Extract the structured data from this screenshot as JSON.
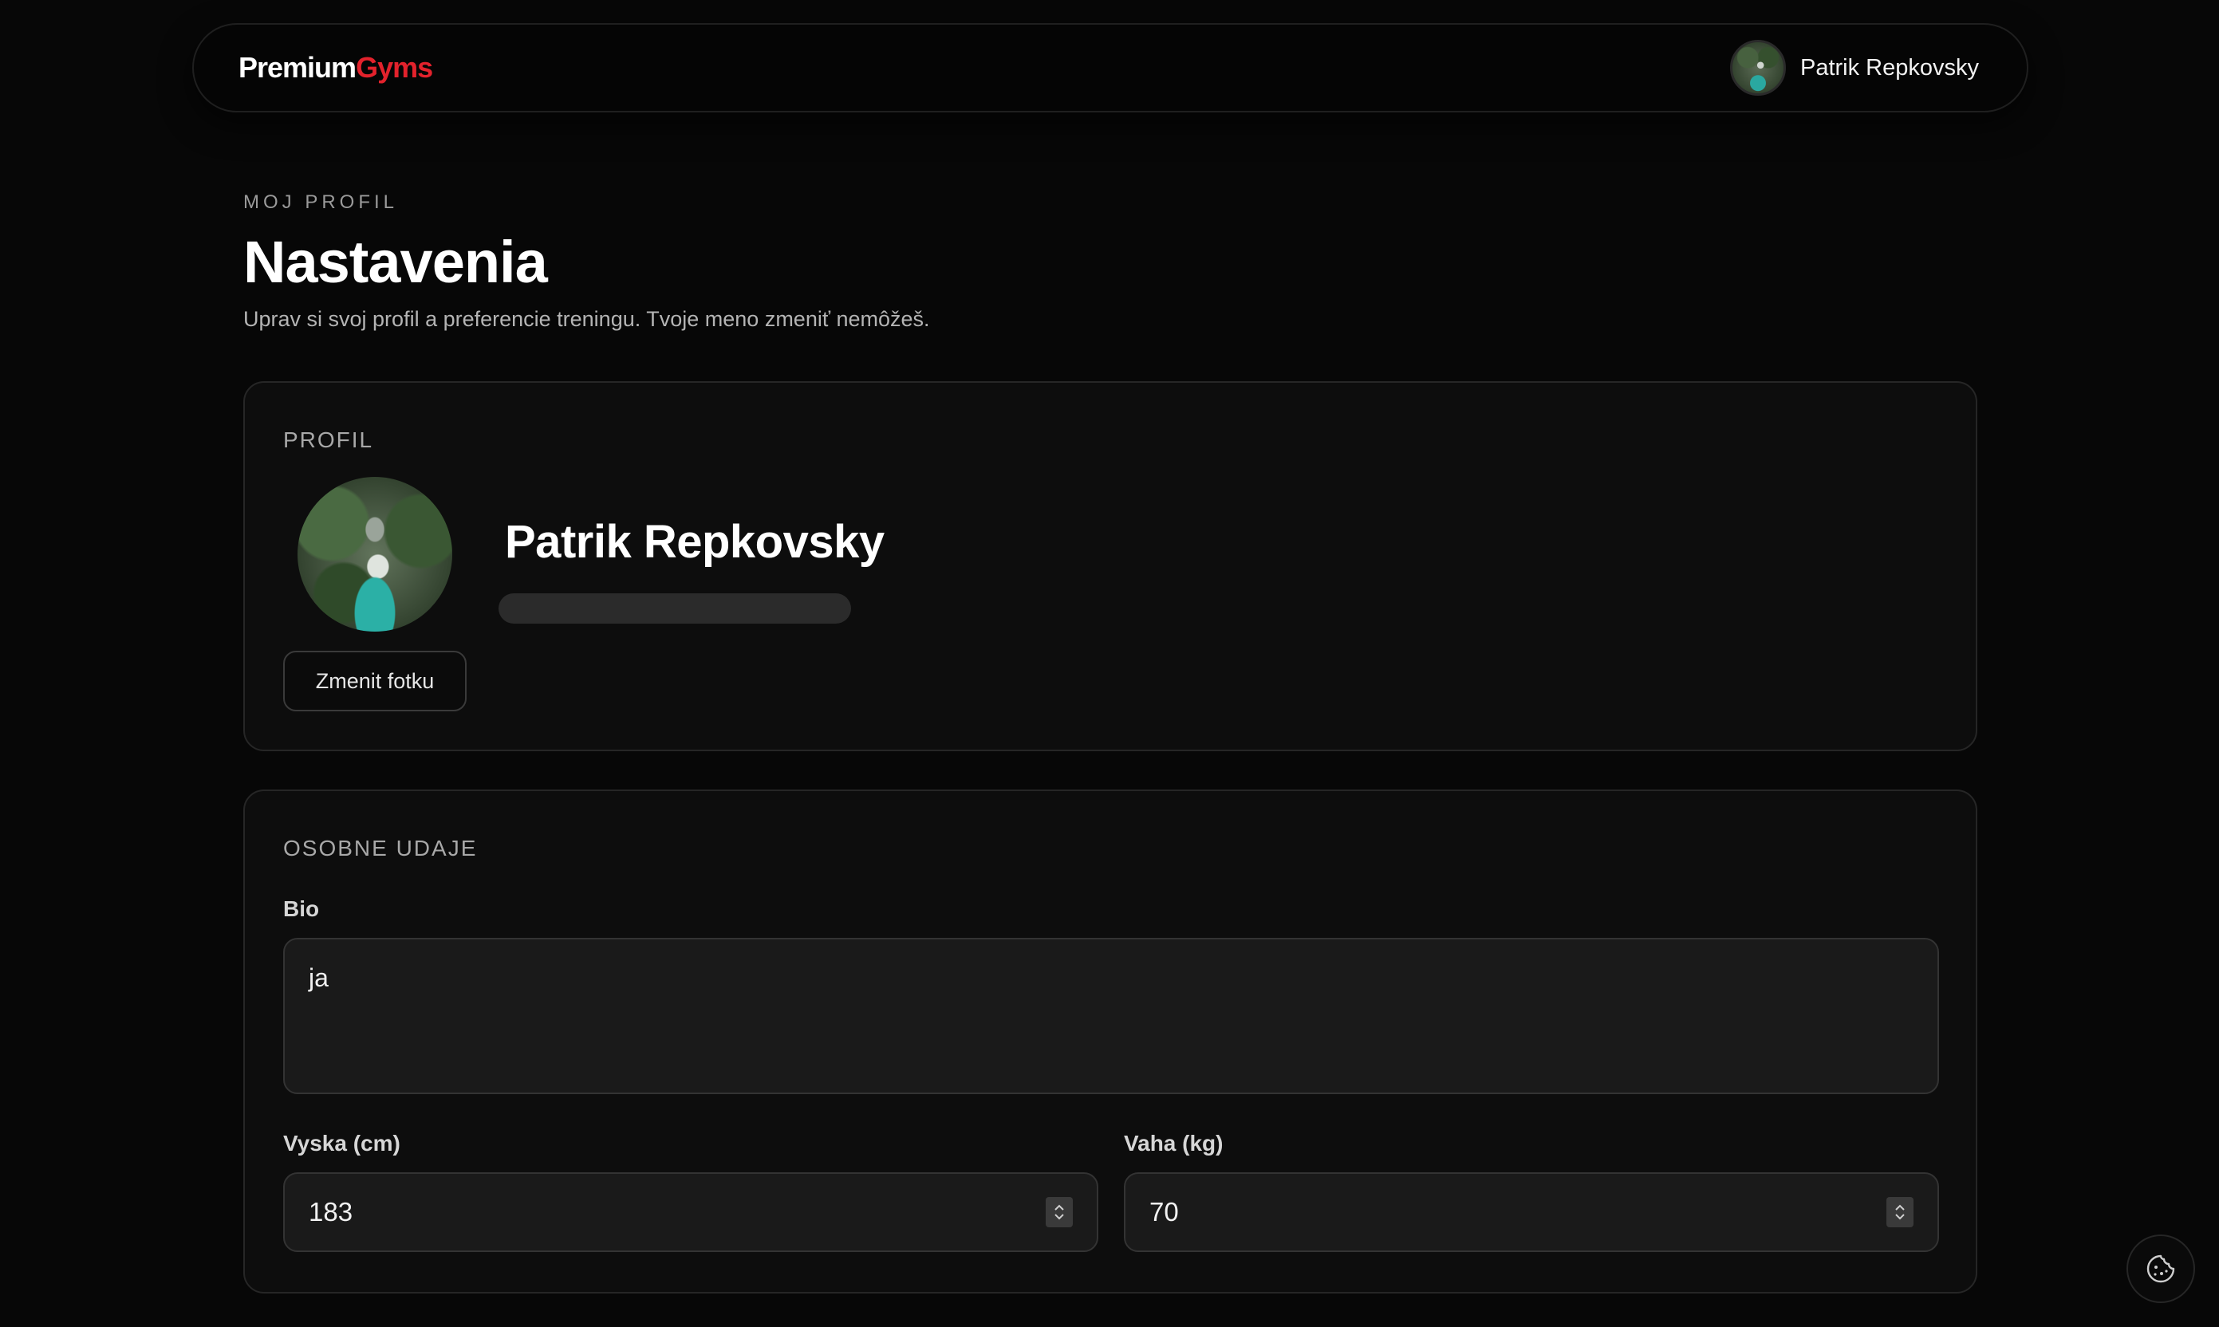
{
  "header": {
    "brand_primary": "Premium",
    "brand_accent": "Gyms",
    "brand_accent_color": "#e3222c",
    "user_name": "Patrik Repkovsky",
    "avatar_icon": "user-avatar-photo"
  },
  "page": {
    "eyebrow": "MOJ PROFIL",
    "title": "Nastavenia",
    "subtitle": "Uprav si svoj profil a preferencie treningu. Tvoje meno zmeniť nemôžeš."
  },
  "profile_card": {
    "title": "PROFIL",
    "name": "Patrik Repkovsky",
    "change_photo_label": "Zmenit fotku"
  },
  "personal_card": {
    "title": "OSOBNE UDAJE",
    "bio_label": "Bio",
    "bio_value": "ja",
    "height_label": "Vyska (cm)",
    "height_value": "183",
    "weight_label": "Vaha (kg)",
    "weight_value": "70"
  },
  "cookie_icon": "cookie-icon"
}
